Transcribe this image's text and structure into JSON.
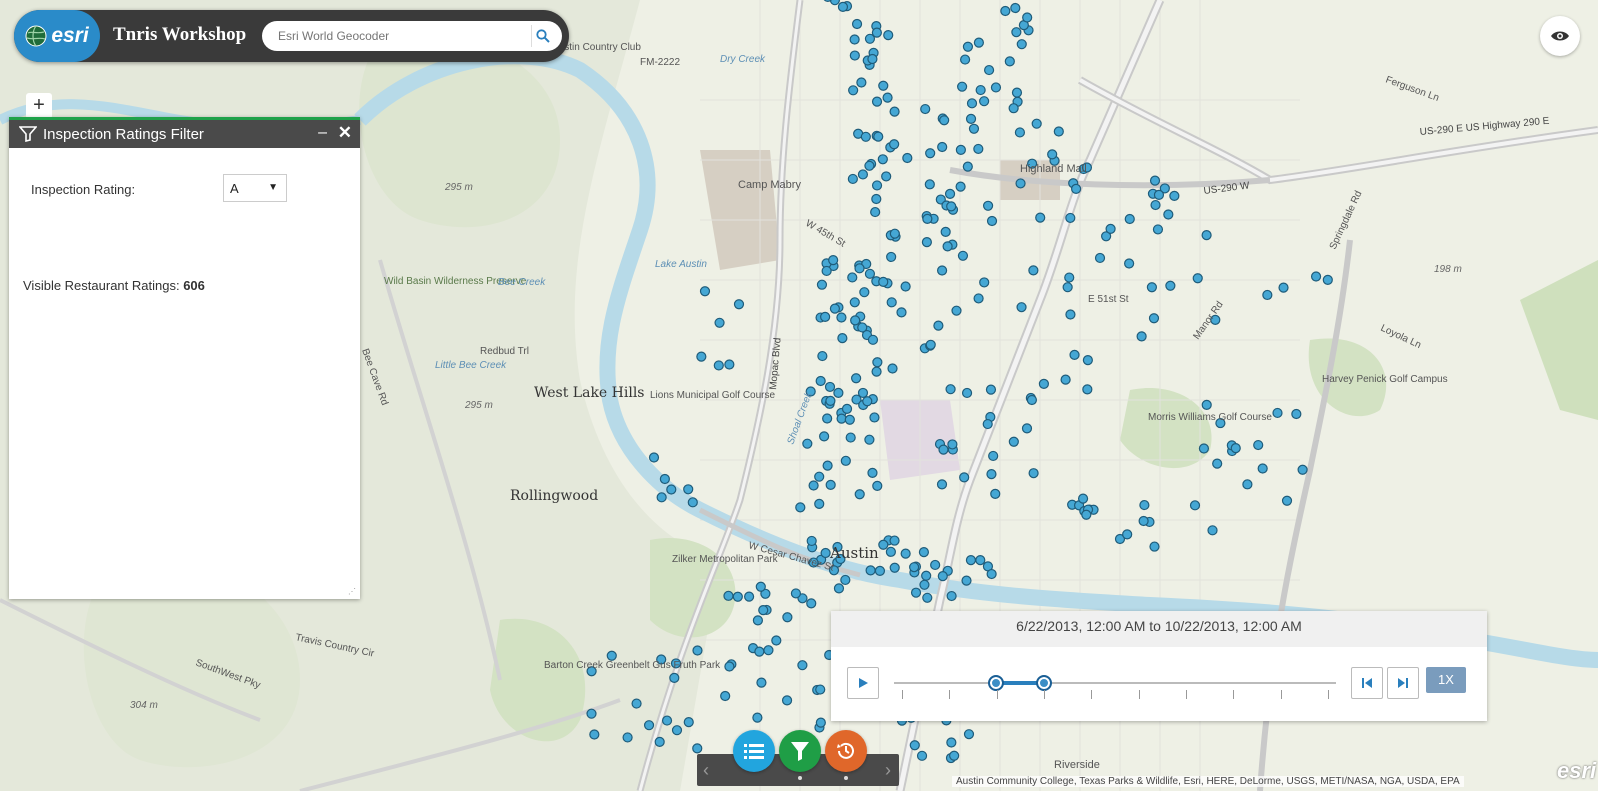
{
  "header": {
    "logo_text": "esri",
    "app_title": "Tnris Workshop",
    "search_placeholder": "Esri World Geocoder"
  },
  "zoom": {
    "in_label": "+"
  },
  "panel": {
    "title": "Inspection Ratings Filter",
    "minimize_label": "–",
    "close_label": "✕",
    "rating_label": "Inspection Rating:",
    "rating_value": "A",
    "visible_label": "Visible Restaurant Ratings: ",
    "visible_count": "606"
  },
  "time_slider": {
    "range_text": "6/22/2013, 12:00 AM to 10/22/2013, 12:00 AM",
    "speed_label": "1X",
    "start_fraction": 0.23,
    "end_fraction": 0.34,
    "tick_count": 10
  },
  "attribution": "Austin Community College, Texas Parks & Wildlife, Esri, HERE, DeLorme, USGS, METI/NASA, NGA, USDA, EPA",
  "watermark": "esri",
  "map_labels": {
    "austin": "Austin",
    "west_lake_hills": "West Lake Hills",
    "rollingwood": "Rollingwood",
    "camp_mabry": "Camp Mabry",
    "highland_mall": "Highland Mall",
    "zilker": "Zilker Metropolitan Park",
    "lions": "Lions Municipal Golf Course",
    "morris": "Morris Williams Golf Course",
    "harvey": "Harvey Penick Golf Campus",
    "barton": "Barton Creek Greenbelt Gus Fruth Park",
    "riverside": "Riverside",
    "wild_basin": "Wild Basin Wilderness Preserve",
    "lake_austin": "Lake Austin",
    "us290e": "US-290 E US Highway 290 E",
    "us290w": "US-290 W",
    "mopac": "Mopac Blvd",
    "w45": "W 45th St",
    "e51": "E 51st St",
    "cesar": "W Cesar Chavez St",
    "manor": "Manor Rd",
    "loyola": "Loyola Ln",
    "ferguson": "Ferguson Ln",
    "springdale": "Springdale Rd",
    "southwest": "SouthWest Pky",
    "travis": "Travis Country Cir",
    "bee_cave": "Bee Cave Rd",
    "m295a": "295 m",
    "m295b": "295 m",
    "m198": "198 m",
    "m304": "304 m",
    "fm2222": "FM-2222",
    "redbud": "Redbud Trl",
    "bee_creek": "Bee Creek",
    "little_bee": "Little Bee Creek",
    "dry_creek": "Dry Creek",
    "shoal": "Shoal Creek",
    "austin_club": "Austin Country Club"
  }
}
